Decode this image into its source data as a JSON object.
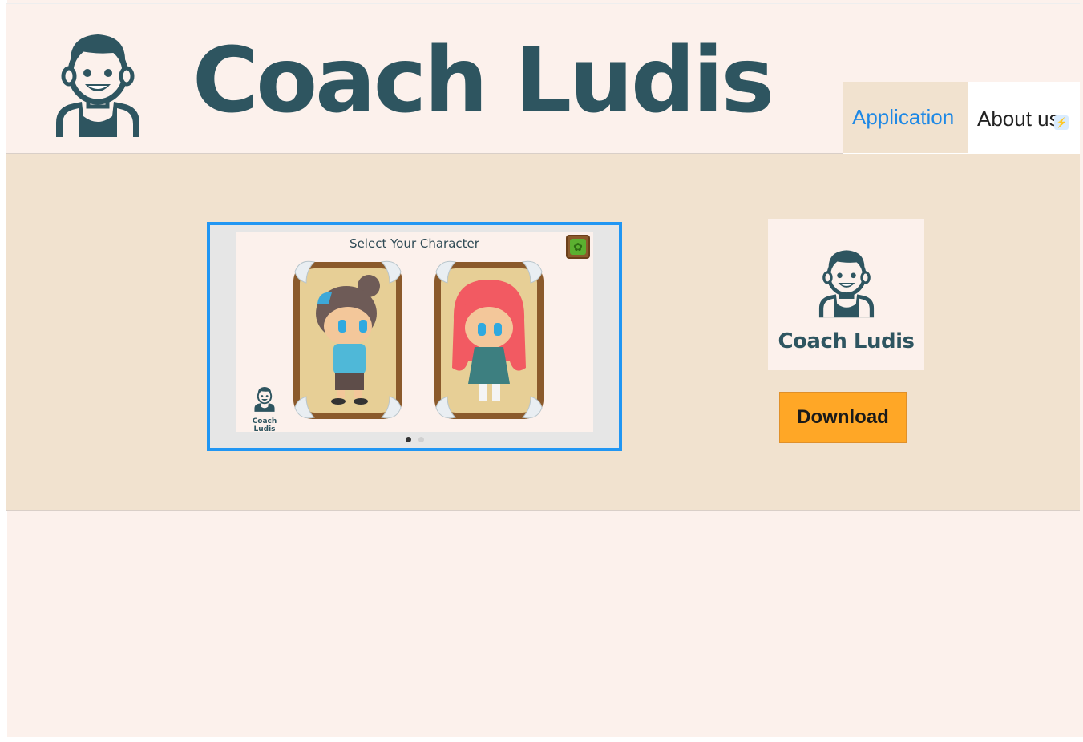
{
  "header": {
    "brand_name": "Coach Ludis",
    "logo_icon": "coach-mascot-icon"
  },
  "nav": {
    "tabs": [
      {
        "label": "Application",
        "active": true
      },
      {
        "label": "About us",
        "active": false
      }
    ],
    "badge_icon": "lightning-icon"
  },
  "carousel": {
    "slide_title": "Select Your Character",
    "settings_icon": "gear-icon",
    "characters": [
      "boy-character",
      "girl-character"
    ],
    "watermark_label": "Coach Ludis",
    "slide_count": 2,
    "active_slide": 1
  },
  "aside": {
    "logo_label": "Coach Ludis",
    "download_label": "Download"
  },
  "colors": {
    "brand": "#2e5560",
    "accent_blue": "#1e88e5",
    "download": "#ffa726",
    "band": "#f1e2cf",
    "page": "#fcf1ec"
  }
}
